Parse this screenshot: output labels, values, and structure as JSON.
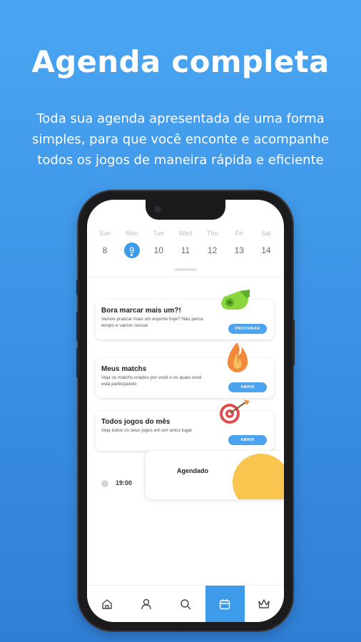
{
  "headline": "Agenda completa",
  "subtitle": "Toda sua agenda apresentada de uma forma simples, para que você enconte e acompanhe todos os jogos de maneira rápida e eficiente",
  "week": [
    {
      "name": "Sun",
      "num": "8"
    },
    {
      "name": "Mon",
      "num": "9",
      "active": true
    },
    {
      "name": "Tue",
      "num": "10"
    },
    {
      "name": "Wed",
      "num": "11"
    },
    {
      "name": "Thu",
      "num": "12"
    },
    {
      "name": "Fri",
      "num": "13"
    },
    {
      "name": "Sat",
      "num": "14"
    }
  ],
  "cards": [
    {
      "title": "Bora marcar mais um?!",
      "desc": "Vamos praticar mais um esporte hoje? Não perca tempo e vamos nessa!",
      "button": "PROCURAR",
      "icon": "whistle-icon"
    },
    {
      "title": "Meus matchs",
      "desc": "Veja os matchs criados por você e os quais você está participando",
      "button": "ABRIR",
      "icon": "fire-icon"
    },
    {
      "title": "Todos jogos do mês",
      "desc": "Veja todos os seus jogos em um unico lugar",
      "button": "ABRIR",
      "icon": "dart-target-icon"
    }
  ],
  "event": {
    "time": "19:00",
    "label": "Agendado"
  },
  "tabs": [
    "home-icon",
    "profile-icon",
    "search-icon",
    "calendar-icon",
    "crown-icon"
  ],
  "colors": {
    "accent": "#3d9be9",
    "event_blob": "#f9c54e",
    "background": "#3d94e6"
  }
}
